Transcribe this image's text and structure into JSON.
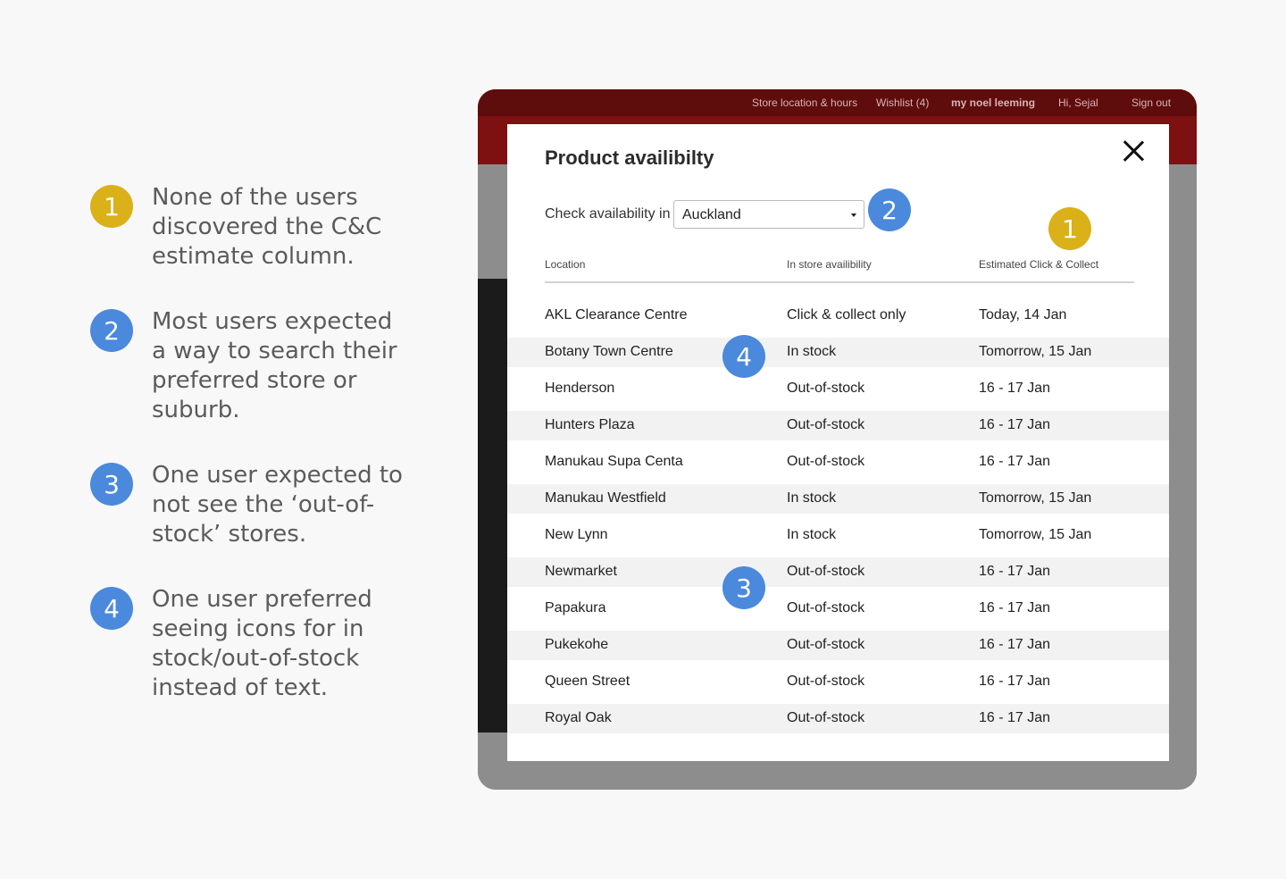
{
  "notes": [
    {
      "number": "1",
      "text": "None of the users discovered the C&C estimate column."
    },
    {
      "number": "2",
      "text": "Most users expected a way to search their preferred store or suburb."
    },
    {
      "number": "3",
      "text": "One user expected to not see the ‘out-of-stock’ stores."
    },
    {
      "number": "4",
      "text": "One user preferred seeing icons for in stock/out-of-stock instead of text."
    }
  ],
  "site_header": {
    "store_location": "Store location & hours",
    "wishlist": "Wishlist (4)",
    "brand": "my noel leeming",
    "greeting": "Hi, Sejal",
    "sign_out": "Sign out"
  },
  "modal": {
    "title": "Product availibilty",
    "check_label": "Check availability in",
    "region": "Auckland",
    "columns": [
      "Location",
      "In store availibility",
      "Estimated Click & Collect"
    ],
    "rows": [
      [
        "AKL Clearance Centre",
        "Click & collect only",
        "Today, 14 Jan"
      ],
      [
        "Botany Town Centre",
        "In stock",
        "Tomorrow, 15 Jan"
      ],
      [
        "Henderson",
        "Out-of-stock",
        "16 - 17 Jan"
      ],
      [
        "Hunters Plaza",
        "Out-of-stock",
        "16 - 17 Jan"
      ],
      [
        "Manukau Supa Centa",
        "Out-of-stock",
        "16 - 17 Jan"
      ],
      [
        "Manukau Westfield",
        "In stock",
        "Tomorrow, 15 Jan"
      ],
      [
        "New Lynn",
        "In stock",
        "Tomorrow, 15 Jan"
      ],
      [
        "Newmarket",
        "Out-of-stock",
        "16 - 17 Jan"
      ],
      [
        "Papakura",
        "Out-of-stock",
        "16 - 17 Jan"
      ],
      [
        "Pukekohe",
        "Out-of-stock",
        "16 - 17 Jan"
      ],
      [
        "Queen Street",
        "Out-of-stock",
        "16 - 17 Jan"
      ],
      [
        "Royal Oak",
        "Out-of-stock",
        "16 - 17 Jan"
      ]
    ]
  },
  "badges": {
    "one": "1",
    "two": "2",
    "three": "3",
    "four": "4"
  },
  "colors": {
    "gold": "#dab118",
    "blue": "#4a89dc",
    "header_red": "#7d1111"
  }
}
